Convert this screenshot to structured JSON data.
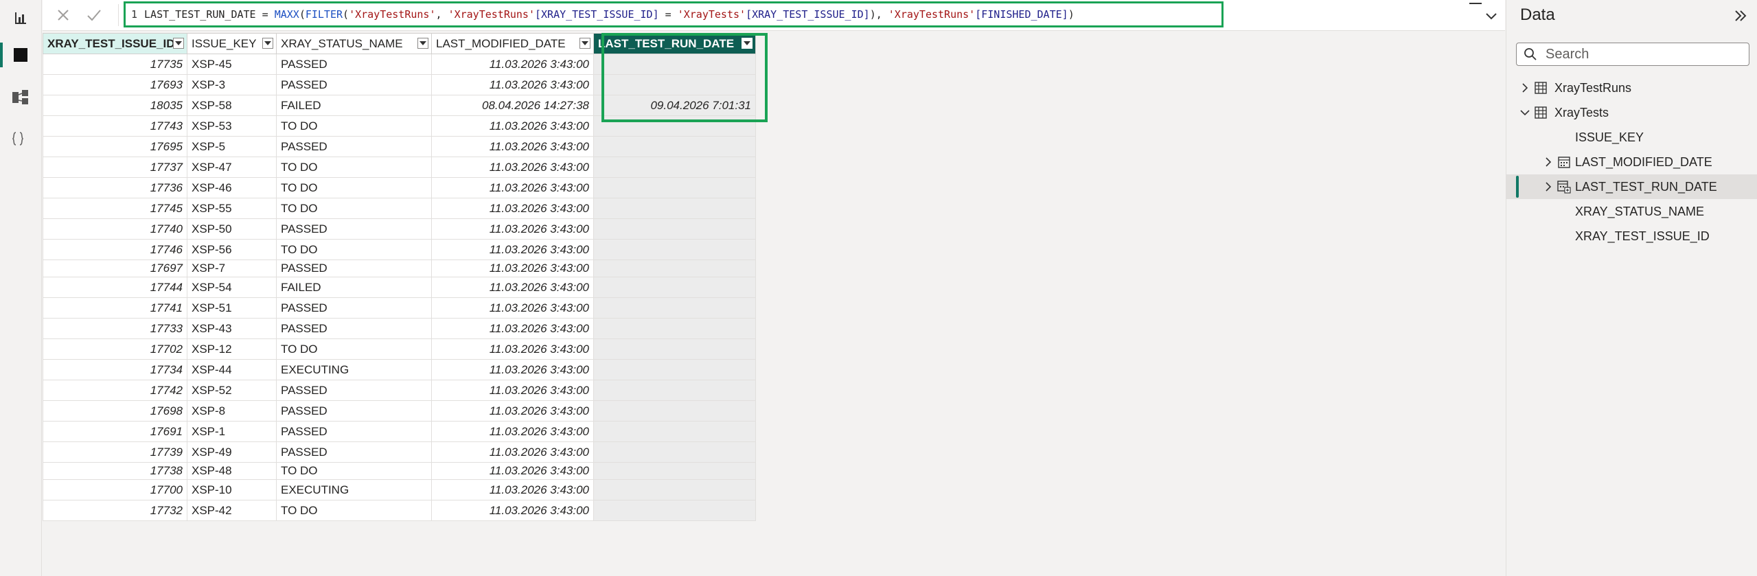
{
  "rail": {
    "items": [
      {
        "name": "report-view",
        "icon": "bar-chart-icon"
      },
      {
        "name": "table-view",
        "icon": "table-icon",
        "active": true
      },
      {
        "name": "model-view",
        "icon": "model-icon"
      },
      {
        "name": "dax-query-view",
        "icon": "dax-icon",
        "label": "DAX"
      }
    ]
  },
  "formula_bar": {
    "line_number": "1",
    "measure_name": "LAST_TEST_RUN_DATE",
    "eq": " = ",
    "fn_maxx": "MAXX",
    "p1": "(",
    "fn_filter": "FILTER",
    "p2": "(",
    "t1": "'XrayTestRuns'",
    "c1": ", ",
    "t2": "'XrayTestRuns'",
    "col1": "[XRAY_TEST_ISSUE_ID]",
    "eq2": " = ",
    "t3": "'XrayTests'",
    "col2": "[XRAY_TEST_ISSUE_ID]",
    "p3": "),",
    "sp": " ",
    "t4": "'XrayTestRuns'",
    "col3": "[FINISHED_DATE]",
    "p4": ")"
  },
  "table": {
    "columns": [
      "XRAY_TEST_ISSUE_ID",
      "ISSUE_KEY",
      "XRAY_STATUS_NAME",
      "LAST_MODIFIED_DATE",
      "LAST_TEST_RUN_DATE"
    ],
    "rows": [
      [
        "17735",
        "XSP-45",
        "PASSED",
        "11.03.2026 3:43:00",
        ""
      ],
      [
        "17693",
        "XSP-3",
        "PASSED",
        "11.03.2026 3:43:00",
        ""
      ],
      [
        "18035",
        "XSP-58",
        "FAILED",
        "08.04.2026 14:27:38",
        "09.04.2026 7:01:31"
      ],
      [
        "17743",
        "XSP-53",
        "TO DO",
        "11.03.2026 3:43:00",
        ""
      ],
      [
        "17695",
        "XSP-5",
        "PASSED",
        "11.03.2026 3:43:00",
        ""
      ],
      [
        "17737",
        "XSP-47",
        "TO DO",
        "11.03.2026 3:43:00",
        ""
      ],
      [
        "17736",
        "XSP-46",
        "TO DO",
        "11.03.2026 3:43:00",
        ""
      ],
      [
        "17745",
        "XSP-55",
        "TO DO",
        "11.03.2026 3:43:00",
        ""
      ],
      [
        "17740",
        "XSP-50",
        "PASSED",
        "11.03.2026 3:43:00",
        ""
      ],
      [
        "17746",
        "XSP-56",
        "TO DO",
        "11.03.2026 3:43:00",
        ""
      ],
      [
        "17697",
        "XSP-7",
        "PASSED",
        "11.03.2026 3:43:00",
        ""
      ],
      [
        "17744",
        "XSP-54",
        "FAILED",
        "11.03.2026 3:43:00",
        ""
      ],
      [
        "17741",
        "XSP-51",
        "PASSED",
        "11.03.2026 3:43:00",
        ""
      ],
      [
        "17733",
        "XSP-43",
        "PASSED",
        "11.03.2026 3:43:00",
        ""
      ],
      [
        "17702",
        "XSP-12",
        "TO DO",
        "11.03.2026 3:43:00",
        ""
      ],
      [
        "17734",
        "XSP-44",
        "EXECUTING",
        "11.03.2026 3:43:00",
        ""
      ],
      [
        "17742",
        "XSP-52",
        "PASSED",
        "11.03.2026 3:43:00",
        ""
      ],
      [
        "17698",
        "XSP-8",
        "PASSED",
        "11.03.2026 3:43:00",
        ""
      ],
      [
        "17691",
        "XSP-1",
        "PASSED",
        "11.03.2026 3:43:00",
        ""
      ],
      [
        "17739",
        "XSP-49",
        "PASSED",
        "11.03.2026 3:43:00",
        ""
      ],
      [
        "17738",
        "XSP-48",
        "TO DO",
        "11.03.2026 3:43:00",
        ""
      ],
      [
        "17700",
        "XSP-10",
        "EXECUTING",
        "11.03.2026 3:43:00",
        ""
      ],
      [
        "17732",
        "XSP-42",
        "TO DO",
        "11.03.2026 3:43:00",
        ""
      ]
    ]
  },
  "data_pane": {
    "title": "Data",
    "search_placeholder": "Search",
    "tables": [
      {
        "name": "XrayTestRuns",
        "expanded": false
      },
      {
        "name": "XrayTests",
        "expanded": true
      }
    ],
    "fields": [
      {
        "name": "ISSUE_KEY",
        "type": "plain"
      },
      {
        "name": "LAST_MODIFIED_DATE",
        "type": "date-hierarchy"
      },
      {
        "name": "LAST_TEST_RUN_DATE",
        "type": "calc-date-hierarchy",
        "selected": true
      },
      {
        "name": "XRAY_STATUS_NAME",
        "type": "plain"
      },
      {
        "name": "XRAY_TEST_ISSUE_ID",
        "type": "plain"
      }
    ]
  },
  "colors": {
    "accent": "#117865",
    "active_header": "#0e5e53",
    "highlight_box": "#1aa355",
    "selected_header": "#d9f3ee"
  }
}
